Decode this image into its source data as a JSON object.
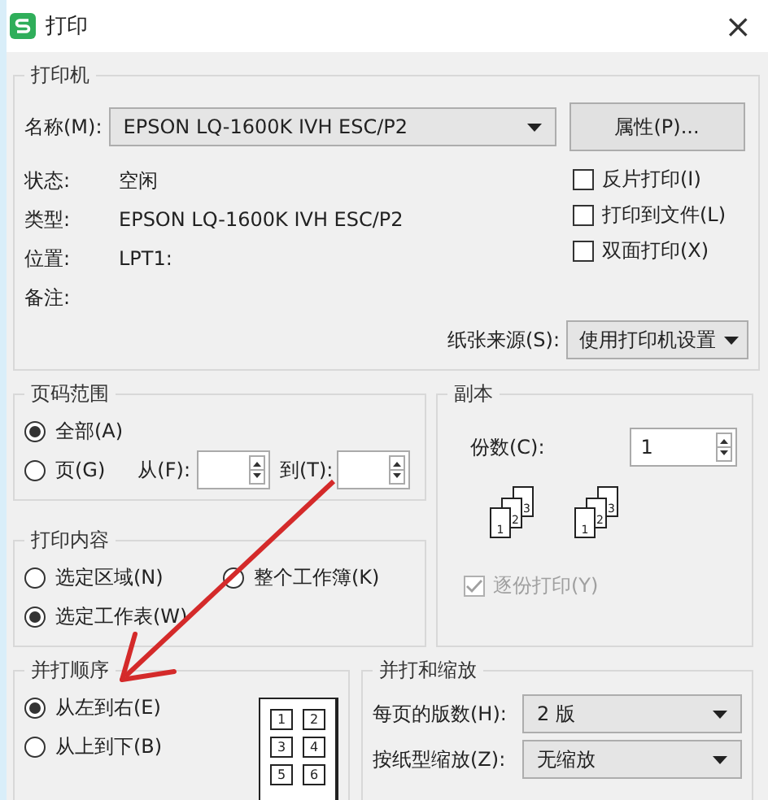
{
  "window": {
    "title": "打印",
    "close": "×"
  },
  "printer": {
    "title": "打印机",
    "name_label": "名称(M):",
    "name": "EPSON LQ-1600K IVH ESC/P2",
    "properties_button": "属性(P)...",
    "info": [
      {
        "label": "状态:",
        "value": "空闲"
      },
      {
        "label": "类型:",
        "value": "EPSON LQ-1600K IVH ESC/P2"
      },
      {
        "label": "位置:",
        "value": "LPT1:"
      },
      {
        "label": "备注:"
      }
    ],
    "options": [
      {
        "label": "反片打印(I)",
        "checked": false
      },
      {
        "label": "打印到文件(L)",
        "checked": false
      },
      {
        "label": "双面打印(X)",
        "checked": false
      }
    ],
    "paper_source": {
      "label": "纸张来源(S):",
      "value": "使用打印机设置"
    }
  },
  "page_range": {
    "title": "页码范围",
    "options": [
      {
        "label": "全部(A)",
        "selected": true
      },
      {
        "label": "页(G)",
        "selected": false
      }
    ],
    "from_label": "从(F):",
    "to_label": "到(T):"
  },
  "copies": {
    "title": "副本",
    "count_label": "份数(C):",
    "count": "1",
    "stacks": [
      [
        "1",
        "2",
        "3"
      ],
      [
        "1",
        "2",
        "3"
      ]
    ],
    "collate": {
      "label": "逐份打印(Y)",
      "checked": true,
      "disabled": true
    }
  },
  "print_content": {
    "title": "打印内容",
    "options": [
      {
        "label": "选定区域(N)",
        "selected": false
      },
      {
        "label": "整个工作簿(K)",
        "selected": false
      },
      {
        "label": "选定工作表(W)",
        "selected": true
      }
    ]
  },
  "order": {
    "title": "并打顺序",
    "options": [
      {
        "label": "从左到右(E)",
        "selected": true
      },
      {
        "label": "从上到下(B)",
        "selected": false
      }
    ],
    "preview": [
      "1",
      "2",
      "3",
      "4",
      "5",
      "6"
    ]
  },
  "scaling": {
    "title": "并打和缩放",
    "fields": [
      {
        "label": "每页的版数(H):",
        "value": "2 版"
      },
      {
        "label": "按纸型缩放(Z):",
        "value": "无缩放"
      }
    ]
  }
}
